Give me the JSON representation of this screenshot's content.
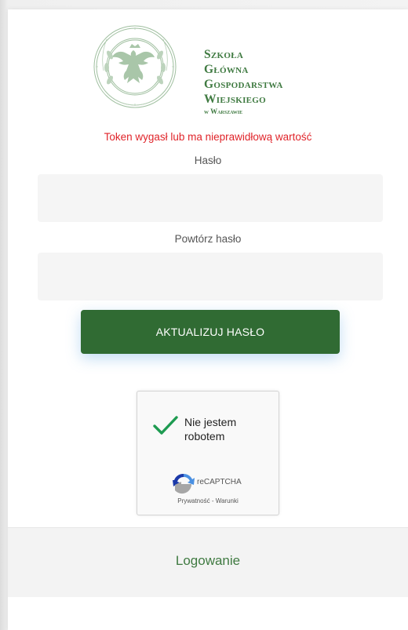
{
  "brand": {
    "line1": "Szkoła Główna",
    "line2": "Gospodarstwa",
    "line3": "Wiejskiego",
    "line4": "w Warszawie",
    "color": "#3f7a41"
  },
  "form": {
    "error_message": "Token wygasł lub ma nieprawidłową wartość",
    "password_label": "Hasło",
    "password_value": "",
    "repeat_label": "Powtórz hasło",
    "repeat_value": "",
    "submit_label": "AKTUALIZUJ HASŁO",
    "submit_color": "#306b33",
    "error_color": "#e0242a"
  },
  "captcha": {
    "label": "Nie jestem robotem",
    "checked": true,
    "brand": "reCAPTCHA",
    "privacy": "Prywatność",
    "separator": " - ",
    "terms": "Warunki"
  },
  "footer": {
    "login_link": "Logowanie"
  }
}
